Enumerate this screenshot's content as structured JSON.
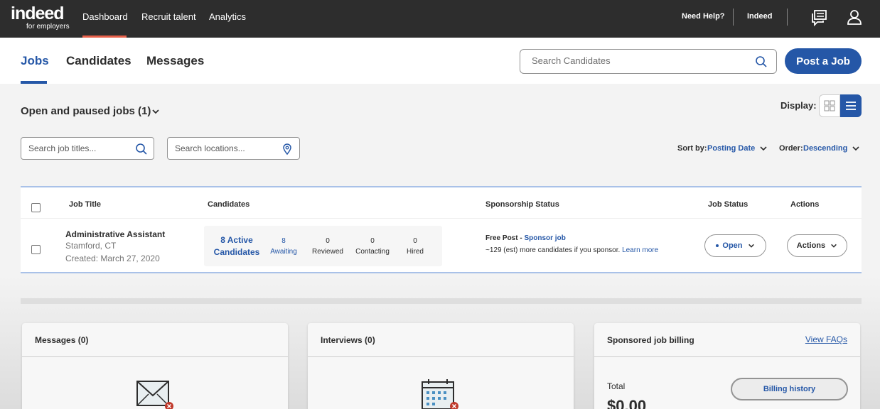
{
  "topbar": {
    "logo_main": "indeed",
    "logo_sub": "for employers",
    "nav": [
      "Dashboard",
      "Recruit talent",
      "Analytics"
    ],
    "active_nav": "Dashboard",
    "need_help": "Need Help?",
    "account": "Indeed",
    "icons": [
      "messages-icon",
      "user-icon"
    ]
  },
  "tabs": {
    "items": [
      "Jobs",
      "Candidates",
      "Messages"
    ],
    "active": "Jobs",
    "search_placeholder": "Search Candidates",
    "post_job": "Post a Job"
  },
  "jobs_filter": {
    "heading": "Open and paused jobs (1)",
    "display_label": "Display:",
    "job_title_placeholder": "Search job titles...",
    "location_placeholder": "Search locations...",
    "sort_label": "Sort by:",
    "sort_value": "Posting Date",
    "order_label": "Order:",
    "order_value": "Descending"
  },
  "table": {
    "headers": [
      "Job Title",
      "Candidates",
      "Sponsorship Status",
      "Job Status",
      "Actions"
    ],
    "row": {
      "title": "Administrative Assistant",
      "location": "Stamford, CT",
      "created": "Created: March 27, 2020",
      "active_candidates_line1": "8 Active",
      "active_candidates_line2": "Candidates",
      "stats": [
        {
          "value": "8",
          "label": "Awaiting"
        },
        {
          "value": "0",
          "label": "Reviewed"
        },
        {
          "value": "0",
          "label": "Contacting"
        },
        {
          "value": "0",
          "label": "Hired"
        }
      ],
      "sponsorship_prefix": "Free Post - ",
      "sponsorship_link": "Sponsor job",
      "sponsorship_note": "~129 (est) more candidates if you sponsor.",
      "learn_more": "Learn more",
      "status": "Open",
      "actions": "Actions"
    }
  },
  "cards": {
    "messages_title": "Messages (0)",
    "interviews_title": "Interviews (0)",
    "billing_title": "Sponsored job billing",
    "faq_link": "View FAQs",
    "total_label": "Total",
    "total_value": "$0.00",
    "billing_history": "Billing history"
  },
  "colors": {
    "brand_blue": "#2557a7",
    "topbar_bg": "#2d2d2d",
    "active_underline": "#e7604a"
  }
}
